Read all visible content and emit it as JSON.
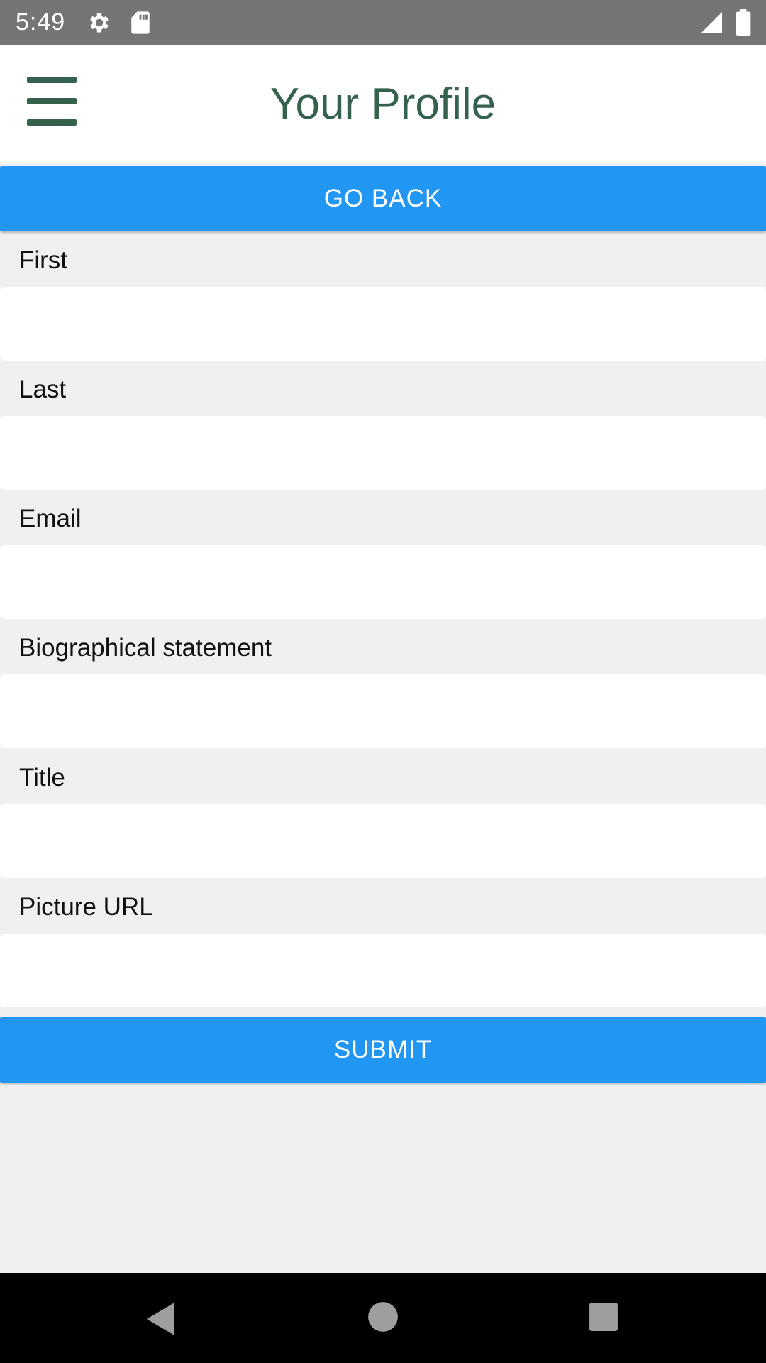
{
  "status_bar": {
    "time": "5:49",
    "icons": [
      "gear-icon",
      "sd-card-icon",
      "signal-icon",
      "battery-icon"
    ]
  },
  "header": {
    "title": "Your Profile",
    "menu_icon": "hamburger-menu-icon"
  },
  "go_back_label": "GO BACK",
  "form": {
    "fields": [
      {
        "label": "First",
        "value": "",
        "placeholder": ""
      },
      {
        "label": "Last",
        "value": "",
        "placeholder": ""
      },
      {
        "label": "Email",
        "value": "",
        "placeholder": ""
      },
      {
        "label": "Biographical statement",
        "value": "",
        "placeholder": ""
      },
      {
        "label": "Title",
        "value": "",
        "placeholder": ""
      },
      {
        "label": "Picture URL",
        "value": "",
        "placeholder": ""
      }
    ]
  },
  "submit_label": "SUBMIT",
  "nav_bar": {
    "icons": [
      "back-triangle-icon",
      "home-circle-icon",
      "recents-square-icon"
    ]
  },
  "colors": {
    "accent": "#2196f3",
    "header_text": "#35624d",
    "background": "#f0f0f0",
    "status_bar": "#757575"
  }
}
